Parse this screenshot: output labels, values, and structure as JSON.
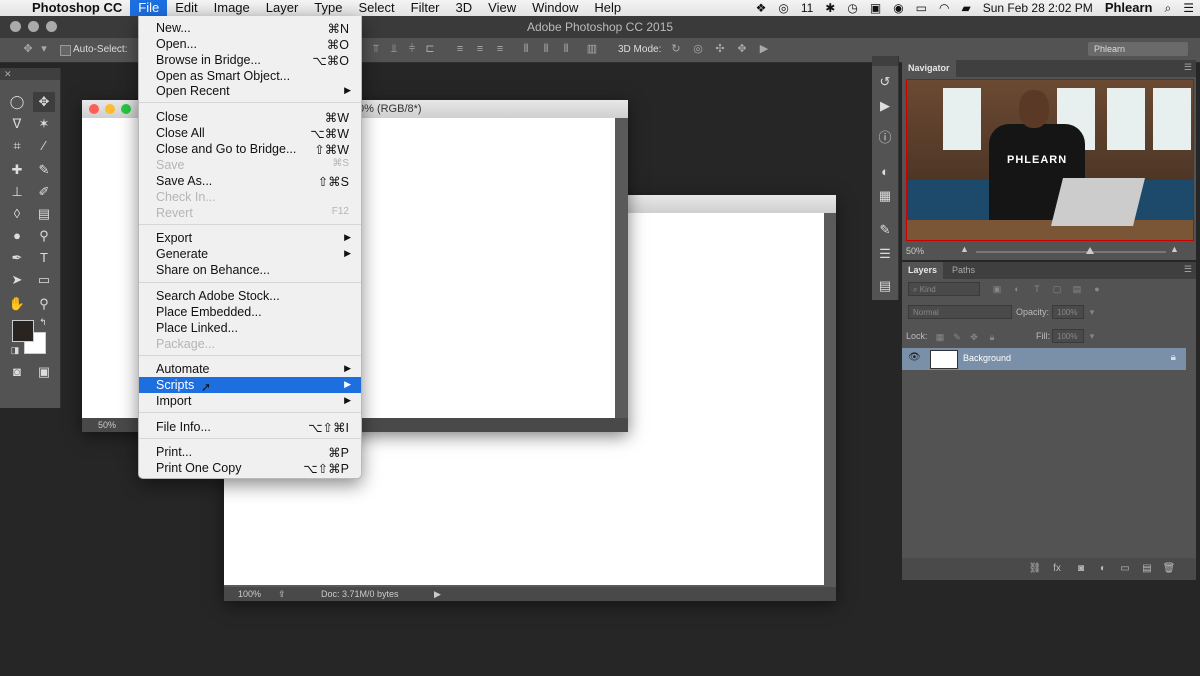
{
  "menubar": {
    "app_name": "Photoshop CC",
    "items": [
      "File",
      "Edit",
      "Image",
      "Layer",
      "Type",
      "Select",
      "Filter",
      "3D",
      "View",
      "Window",
      "Help"
    ],
    "active_item": "File",
    "notification_count": "11",
    "datetime": "Sun Feb 28  2:02 PM",
    "user": "Phlearn"
  },
  "window": {
    "title": "Adobe Photoshop CC 2015"
  },
  "options_bar": {
    "auto_select_label": "Auto-Select:",
    "mode_3d_label": "3D Mode:",
    "workspace": "Phlearn"
  },
  "doc_back": {
    "title_fragment": "0% (RGB/8*)",
    "zoom": "50%"
  },
  "doc_front": {
    "zoom": "100%",
    "doc_info": "Doc: 3.71M/0 bytes"
  },
  "file_menu": {
    "items": [
      {
        "label": "New...",
        "shortcut": "⌘N"
      },
      {
        "label": "Open...",
        "shortcut": "⌘O"
      },
      {
        "label": "Browse in Bridge...",
        "shortcut": "⌥⌘O"
      },
      {
        "label": "Open as Smart Object...",
        "shortcut": ""
      },
      {
        "label": "Open Recent",
        "shortcut": ""
      },
      {
        "label": "Close",
        "shortcut": "⌘W"
      },
      {
        "label": "Close All",
        "shortcut": "⌥⌘W"
      },
      {
        "label": "Close and Go to Bridge...",
        "shortcut": "⇧⌘W"
      },
      {
        "label": "Save",
        "shortcut": "⌘S"
      },
      {
        "label": "Save As...",
        "shortcut": "⇧⌘S"
      },
      {
        "label": "Check In...",
        "shortcut": ""
      },
      {
        "label": "Revert",
        "shortcut": "F12"
      },
      {
        "label": "Export",
        "shortcut": ""
      },
      {
        "label": "Generate",
        "shortcut": ""
      },
      {
        "label": "Share on Behance...",
        "shortcut": ""
      },
      {
        "label": "Search Adobe Stock...",
        "shortcut": ""
      },
      {
        "label": "Place Embedded...",
        "shortcut": ""
      },
      {
        "label": "Place Linked...",
        "shortcut": ""
      },
      {
        "label": "Package...",
        "shortcut": ""
      },
      {
        "label": "Automate",
        "shortcut": ""
      },
      {
        "label": "Scripts",
        "shortcut": ""
      },
      {
        "label": "Import",
        "shortcut": ""
      },
      {
        "label": "File Info...",
        "shortcut": "⌥⇧⌘I"
      },
      {
        "label": "Print...",
        "shortcut": "⌘P"
      },
      {
        "label": "Print One Copy",
        "shortcut": "⌥⇧⌘P"
      }
    ]
  },
  "navigator": {
    "tab": "Navigator",
    "zoom": "50%",
    "shirt_text": "PHLEARN",
    "zoom_level": 0.6
  },
  "layers": {
    "tabs": [
      "Layers",
      "Paths"
    ],
    "filter_kind": "Kind",
    "blend_mode": "Normal",
    "opacity_label": "Opacity:",
    "opacity_value": "100%",
    "lock_label": "Lock:",
    "fill_label": "Fill:",
    "fill_value": "100%",
    "layer_name": "Background"
  }
}
